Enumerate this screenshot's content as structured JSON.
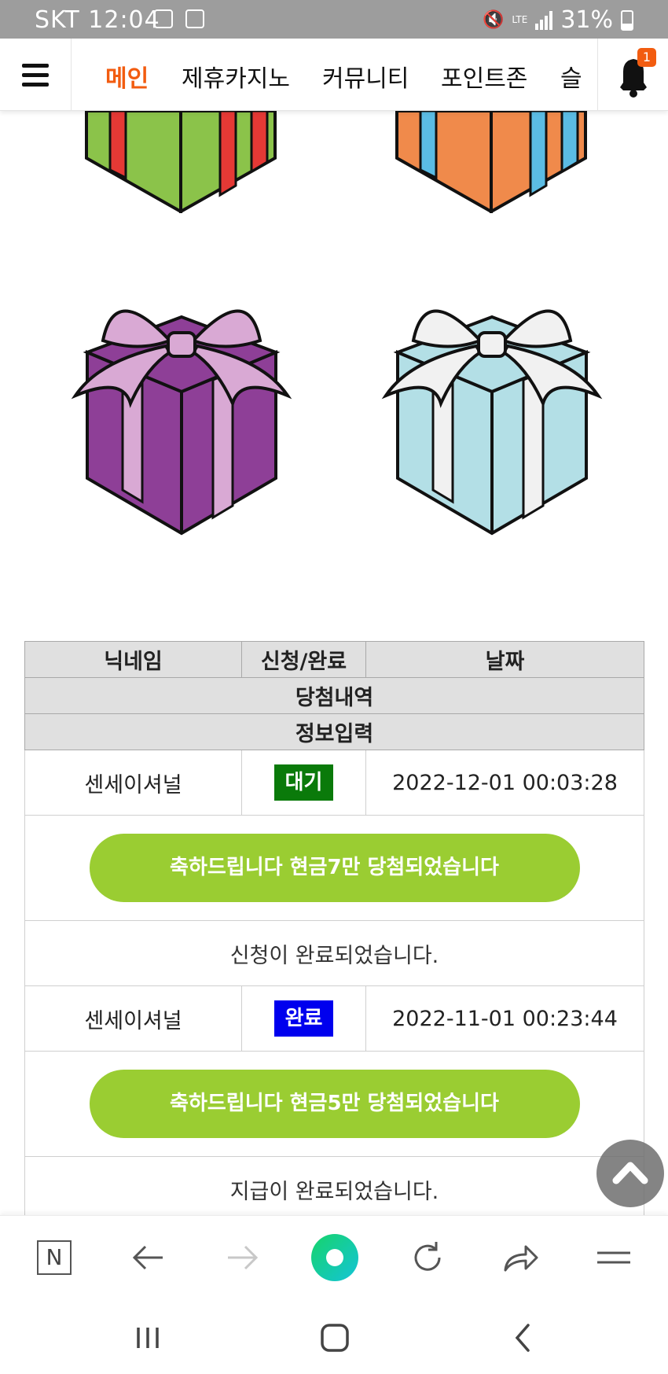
{
  "status_bar": {
    "carrier": "SKT",
    "time": "12:04",
    "network": "LTE",
    "battery": "31%"
  },
  "nav": {
    "items": [
      {
        "label": "메인",
        "active": true
      },
      {
        "label": "제휴카지노",
        "active": false
      },
      {
        "label": "커뮤니티",
        "active": false
      },
      {
        "label": "포인트존",
        "active": false
      },
      {
        "label": "슬",
        "active": false
      }
    ],
    "notification_count": "1"
  },
  "gifts": {
    "top_left_colors": {
      "box": "#8bc34a",
      "ribbon": "#e53935"
    },
    "top_right_colors": {
      "box": "#f08a4b",
      "ribbon": "#5bbce4"
    },
    "bottom_left_colors": {
      "box": "#8e3f97",
      "ribbon": "#d9a9d4"
    },
    "bottom_right_colors": {
      "box": "#b3dfe6",
      "ribbon": "#f1f1f1"
    }
  },
  "table": {
    "headers": [
      "닉네임",
      "신청/완료",
      "날짜"
    ],
    "sub_header_1": "당첨내역",
    "sub_header_2": "정보입력",
    "rows": [
      {
        "nickname": "센세이셔널",
        "status": "대기",
        "date": "2022-12-01 00:03:28",
        "prize": "축하드립니다 현금7만 당첨되었습니다",
        "message": "신청이 완료되었습니다."
      },
      {
        "nickname": "센세이셔널",
        "status": "완료",
        "date": "2022-11-01 00:23:44",
        "prize": "축하드립니다 현금5만 당첨되었습니다",
        "message": "지급이 완료되었습니다."
      }
    ]
  },
  "colors": {
    "accent": "#f25c10",
    "prize_button": "#9acd32",
    "status_wait": "#0a7a0a",
    "status_done": "#0000ee",
    "status_bar_bg": "#9d9d9d"
  },
  "browser_bar": {
    "home_icon_label": "N"
  }
}
